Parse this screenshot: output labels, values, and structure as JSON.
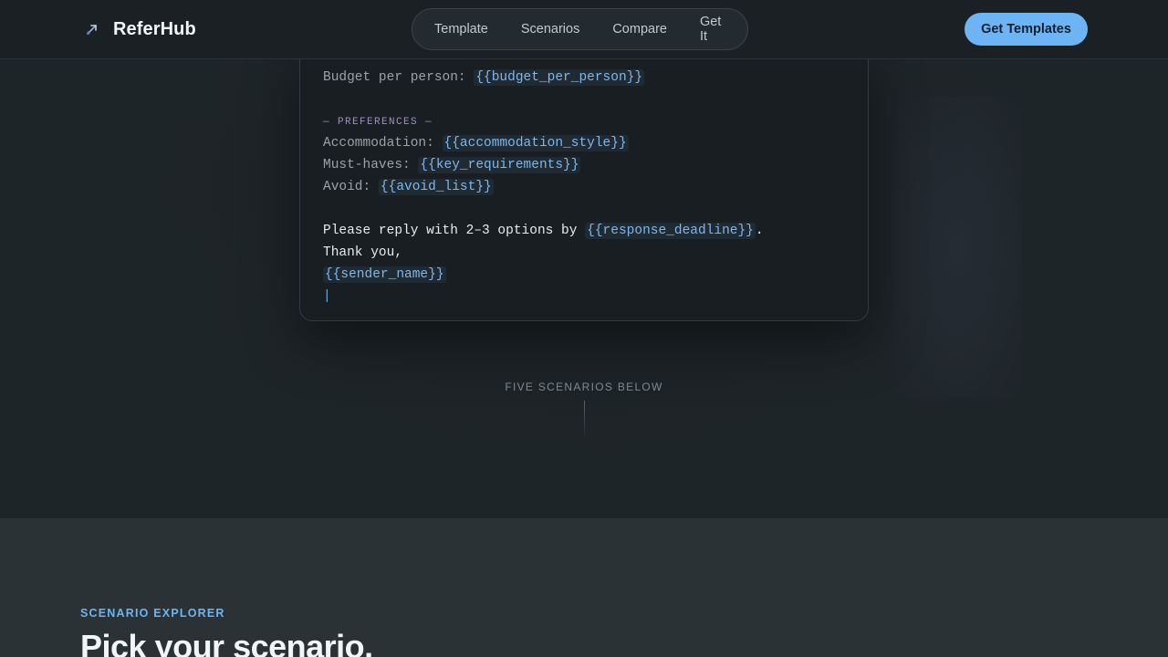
{
  "brand": {
    "name": "ReferHub",
    "icon": "paper-plane-icon"
  },
  "nav": {
    "items": [
      "Template",
      "Scenarios",
      "Compare",
      "Get It"
    ]
  },
  "header": {
    "cta_label": "Get Templates"
  },
  "template": {
    "budget_label": "Budget per person: ",
    "budget_var": "{{budget_per_person}}",
    "preferences_heading": "— PREFERENCES —",
    "accommodation_label": "Accommodation: ",
    "accommodation_var": "{{accommodation_style}}",
    "musthaves_label": "Must-haves: ",
    "musthaves_var": "{{key_requirements}}",
    "avoid_label": "Avoid: ",
    "avoid_var": "{{avoid_list}}",
    "reply_text": "Please reply with 2–3 options by ",
    "reply_var": "{{response_deadline}}",
    "reply_end": ".",
    "thanks": "Thank you,",
    "sender_var": "{{sender_name}}",
    "cursor": "|"
  },
  "scroll_hint": "FIVE SCENARIOS BELOW",
  "explorer": {
    "eyebrow": "SCENARIO EXPLORER",
    "title": "Pick your scenario."
  },
  "colors": {
    "accent": "#6db4f5",
    "variable": "#7fb7ec",
    "section_heading": "#a48ad6"
  }
}
